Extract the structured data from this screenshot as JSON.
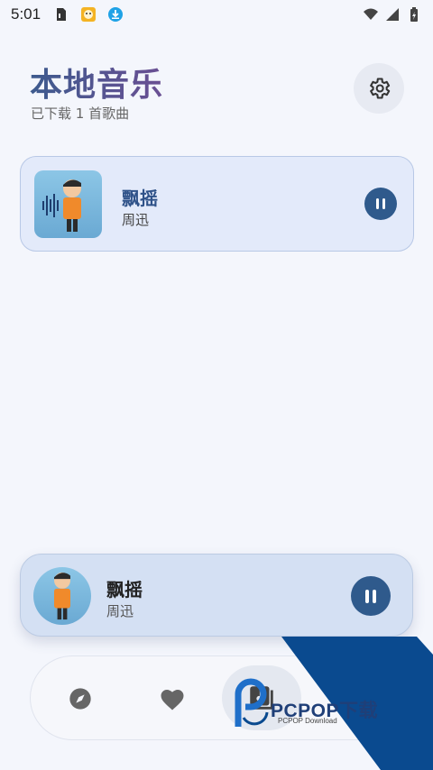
{
  "status_bar": {
    "time": "5:01",
    "left_icons": [
      "sim-card-icon",
      "app-notification-icon",
      "download-icon"
    ],
    "right_icons": [
      "wifi-icon",
      "signal-icon",
      "battery-icon"
    ]
  },
  "header": {
    "title": "本地音乐",
    "subtitle": "已下载 1 首歌曲"
  },
  "settings": {
    "icon": "gear-icon"
  },
  "songs": [
    {
      "title": "飘摇",
      "artist": "周迅",
      "playing": true
    }
  ],
  "now_playing": {
    "title": "飘摇",
    "artist": "周迅",
    "playing": true
  },
  "bottom_nav": {
    "items": [
      {
        "icon": "compass-icon",
        "active": false
      },
      {
        "icon": "heart-icon",
        "active": false
      },
      {
        "icon": "music-library-icon",
        "active": true
      }
    ]
  },
  "watermark": {
    "text": "PCPOP下载",
    "subtext": "PCPOP Download"
  },
  "colors": {
    "accent": "#2f5a8c",
    "title_gradient_start": "#3d5a8e",
    "title_gradient_end": "#6a4f93",
    "card_bg": "#e3eafa",
    "watermark_blue": "#0a4a8f"
  }
}
